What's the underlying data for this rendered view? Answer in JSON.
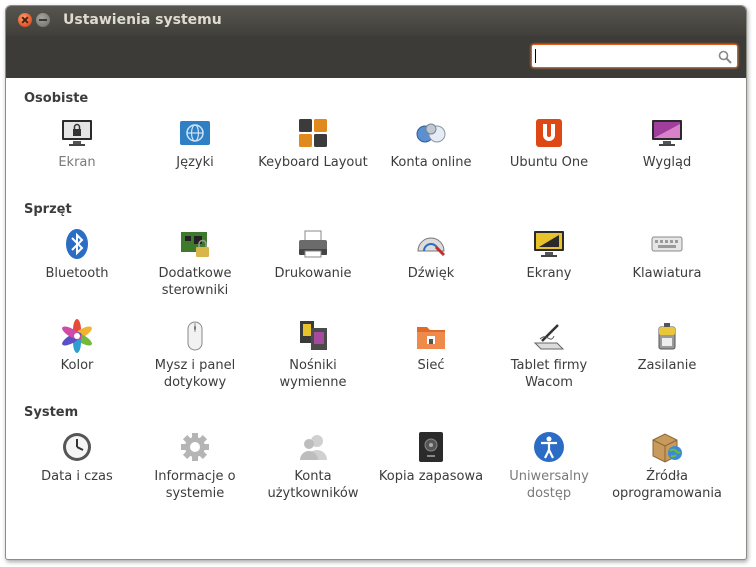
{
  "window": {
    "title": "Ustawienia systemu"
  },
  "search": {
    "value": "",
    "icon": "search-icon"
  },
  "sections": {
    "personal": {
      "title": "Osobiste",
      "items": [
        {
          "label": "Ekran",
          "icon": "screen-lock-icon"
        },
        {
          "label": "Języki",
          "icon": "language-globe-icon"
        },
        {
          "label": "Keyboard Layout",
          "icon": "keyboard-layout-icon"
        },
        {
          "label": "Konta online",
          "icon": "online-accounts-icon"
        },
        {
          "label": "Ubuntu One",
          "icon": "ubuntu-one-icon"
        },
        {
          "label": "Wygląd",
          "icon": "appearance-icon"
        }
      ]
    },
    "hardware": {
      "title": "Sprzęt",
      "items": [
        {
          "label": "Bluetooth",
          "icon": "bluetooth-icon"
        },
        {
          "label": "Dodatkowe sterowniki",
          "icon": "drivers-board-icon"
        },
        {
          "label": "Drukowanie",
          "icon": "printer-icon"
        },
        {
          "label": "Dźwięk",
          "icon": "sound-icon"
        },
        {
          "label": "Ekrany",
          "icon": "displays-icon"
        },
        {
          "label": "Klawiatura",
          "icon": "keyboard-icon"
        },
        {
          "label": "Kolor",
          "icon": "color-icon"
        },
        {
          "label": "Mysz i panel dotykowy",
          "icon": "mouse-icon"
        },
        {
          "label": "Nośniki wymienne",
          "icon": "removable-media-icon"
        },
        {
          "label": "Sieć",
          "icon": "network-icon"
        },
        {
          "label": "Tablet firmy Wacom",
          "icon": "wacom-tablet-icon"
        },
        {
          "label": "Zasilanie",
          "icon": "power-icon"
        }
      ]
    },
    "system": {
      "title": "System",
      "items": [
        {
          "label": "Data i czas",
          "icon": "clock-icon"
        },
        {
          "label": "Informacje o systemie",
          "icon": "gear-icon"
        },
        {
          "label": "Konta użytkowników",
          "icon": "users-icon"
        },
        {
          "label": "Kopia zapasowa",
          "icon": "backup-safe-icon"
        },
        {
          "label": "Uniwersalny dostęp",
          "icon": "accessibility-icon"
        },
        {
          "label": "Źródła oprogramowania",
          "icon": "software-sources-icon"
        }
      ]
    }
  },
  "colors": {
    "titlebar": "#403f3a",
    "accent": "#e05a1b",
    "text": "#3c3c3c"
  }
}
